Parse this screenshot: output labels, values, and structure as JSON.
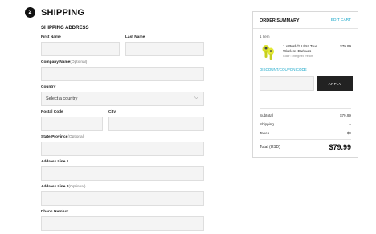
{
  "step": {
    "number": "2",
    "title": "SHIPPING"
  },
  "shipping_address": {
    "title": "SHIPPING ADDRESS",
    "first_name": "First Name",
    "last_name": "Last Name",
    "company_name": "Company Name",
    "company_optional": "(Optional)",
    "country": "Country",
    "country_value": "Select a country",
    "postal_code": "Postal Code",
    "city": "City",
    "state_province": "State/Province",
    "state_optional": "(Optional)",
    "address1": "Address Line 1",
    "address2": "Address Line 2",
    "address2_optional": "(Optional)",
    "phone": "Phone Number"
  },
  "summary": {
    "title": "ORDER SUMMARY",
    "edit_cart": "EDIT CART",
    "item_count": "1 Item",
    "product": {
      "name": "1 x Push™ Ultra True Wireless Earbuds",
      "color": "Color: Energized Yellow",
      "price": "$79.99",
      "icon": "earbuds-image"
    },
    "coupon_label": "DISCOUNT/COUPON CODE",
    "apply": "APPLY",
    "subtotal_label": "Subtotal",
    "subtotal_value": "$79.99",
    "shipping_label": "Shipping",
    "shipping_value": "--",
    "taxes_label": "Taxes",
    "taxes_value": "$0",
    "total_label": "Total (USD)",
    "total_value": "$79.99"
  },
  "colors": {
    "accent": "#19a7c9",
    "dark": "#222222",
    "field": "#f4f4f4"
  }
}
